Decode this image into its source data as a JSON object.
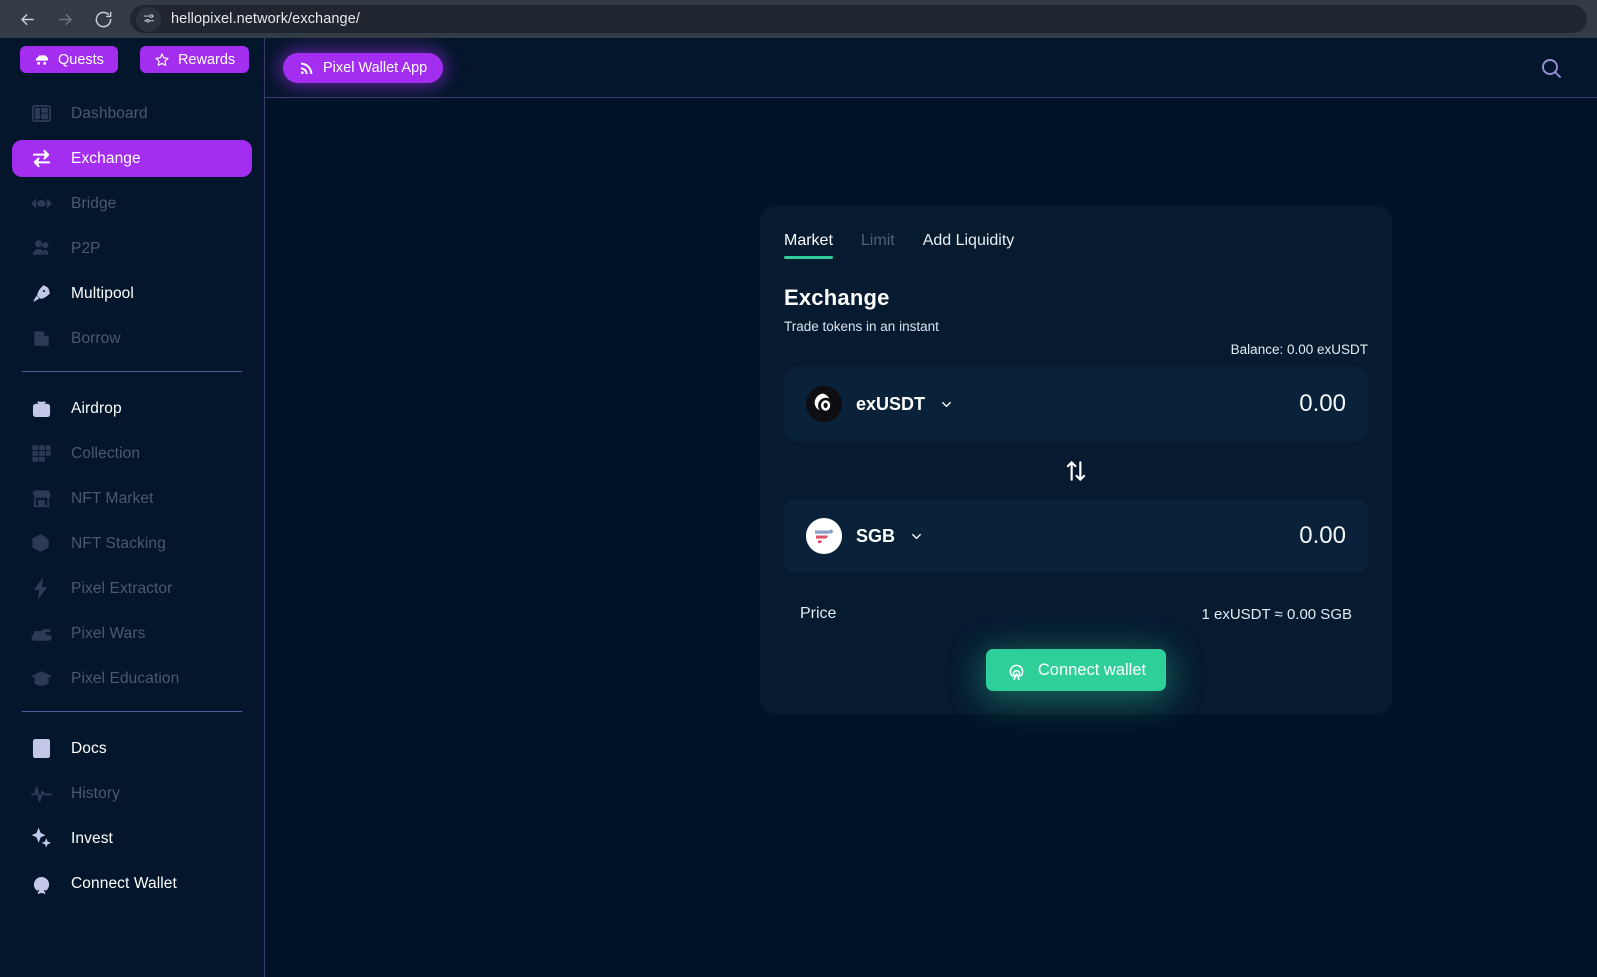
{
  "browser": {
    "back_icon": "back-arrow-icon",
    "forward_icon": "forward-arrow-icon",
    "reload_icon": "reload-icon",
    "site_settings_icon": "site-settings-icon",
    "url": "hellopixel.network/exchange/"
  },
  "sidebar": {
    "top_actions": [
      {
        "label": "Quests",
        "icon": "quest-car-icon"
      },
      {
        "label": "Rewards",
        "icon": "star-icon"
      }
    ],
    "group_one": [
      {
        "label": "Dashboard",
        "icon": "dashboard-icon",
        "state": "dim"
      },
      {
        "label": "Exchange",
        "icon": "exchange-swap-icon",
        "state": "active"
      },
      {
        "label": "Bridge",
        "icon": "bridge-icon",
        "state": "dim"
      },
      {
        "label": "P2P",
        "icon": "people-icon",
        "state": "dim"
      },
      {
        "label": "Multipool",
        "icon": "rocket-icon",
        "state": "bright"
      },
      {
        "label": "Borrow",
        "icon": "borrow-icon",
        "state": "dim"
      }
    ],
    "group_two": [
      {
        "label": "Airdrop",
        "icon": "parachute-box-icon",
        "state": "bright"
      },
      {
        "label": "Collection",
        "icon": "grid-collection-icon",
        "state": "dim"
      },
      {
        "label": "NFT Market",
        "icon": "storefront-icon",
        "state": "dim"
      },
      {
        "label": "NFT Stacking",
        "icon": "cube-plus-icon",
        "state": "dim"
      },
      {
        "label": "Pixel Extractor",
        "icon": "lightning-bolt-icon",
        "state": "dim"
      },
      {
        "label": "Pixel Wars",
        "icon": "tank-icon",
        "state": "dim"
      },
      {
        "label": "Pixel Education",
        "icon": "graduation-cap-icon",
        "state": "dim"
      }
    ],
    "group_three": [
      {
        "label": "Docs",
        "icon": "book-icon",
        "state": "bright"
      },
      {
        "label": "History",
        "icon": "activity-pulse-icon",
        "state": "dim"
      },
      {
        "label": "Invest",
        "icon": "sparkles-icon",
        "state": "bright"
      },
      {
        "label": "Connect Wallet",
        "icon": "antenna-broadcast-icon",
        "state": "bright"
      }
    ]
  },
  "header": {
    "wallet_app_label": "Pixel Wallet App",
    "wallet_app_icon": "signal-broadcast-icon",
    "search_icon": "search-icon"
  },
  "exchange": {
    "tabs": [
      {
        "label": "Market",
        "state": "active"
      },
      {
        "label": "Limit",
        "state": "muted"
      },
      {
        "label": "Add Liquidity",
        "state": "plain"
      }
    ],
    "title": "Exchange",
    "subtitle": "Trade tokens in an instant",
    "balance": "Balance: 0.00 exUSDT",
    "from_token": {
      "symbol": "exUSDT",
      "icon": "exusdt-token-icon",
      "amount": "0.00",
      "placeholder": "0.00"
    },
    "swap_icon": "swap-vertical-arrows-icon",
    "to_token": {
      "symbol": "SGB",
      "icon": "sgb-token-icon",
      "amount": "0.00",
      "placeholder": "0.00"
    },
    "price_label": "Price",
    "price_value": "1 exUSDT ≈ 0.00 SGB",
    "connect_label": "Connect wallet",
    "connect_icon": "antenna-broadcast-icon"
  },
  "colors": {
    "background": "#011327",
    "panel": "#04162b",
    "card": "#061a30",
    "field": "#0a2239",
    "accent_purple": "#a32ef0",
    "accent_green": "#2fcf9a",
    "border_purple": "#3e3a6e",
    "muted_text": "#4a5970"
  }
}
